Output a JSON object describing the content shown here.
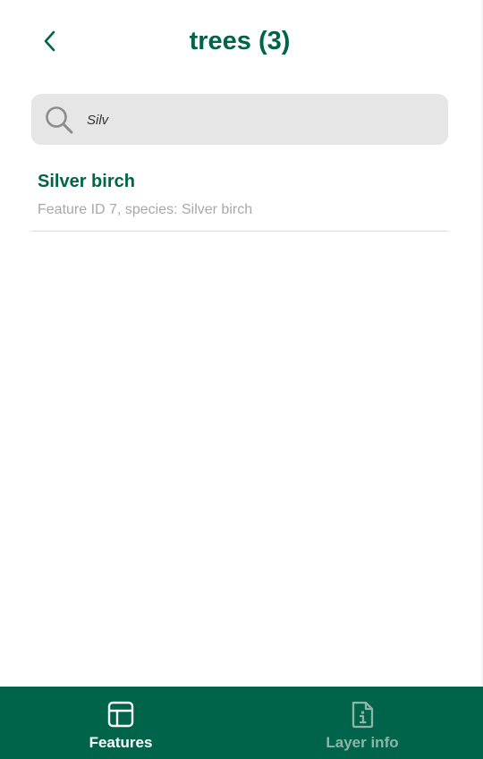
{
  "header": {
    "title": "trees (3)"
  },
  "search": {
    "value": "Silv"
  },
  "results": [
    {
      "title": "Silver birch",
      "subtitle": "Feature ID 7, species: Silver birch"
    }
  ],
  "bottom_nav": {
    "tabs": [
      {
        "label": "Features",
        "icon": "table-icon",
        "active": true
      },
      {
        "label": "Layer info",
        "icon": "info-file-icon",
        "active": false
      }
    ]
  },
  "colors": {
    "primary": "#00644a",
    "search_bg": "#e6e6e6",
    "subtitle": "#a8a8a8",
    "inactive_tab": "#8fb5a9"
  }
}
